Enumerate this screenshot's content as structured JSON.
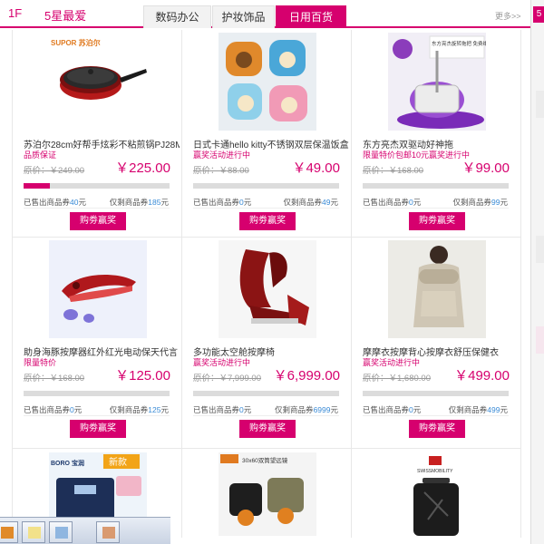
{
  "header": {
    "floor_num": "1F",
    "floor_title": "5星最爱",
    "tabs": [
      "数码办公",
      "护妆饰品",
      "日用百货"
    ],
    "active_tab": "日用百货",
    "more": "更多>>",
    "side_tab": "5"
  },
  "colors": {
    "accent": "#d6006e",
    "count": "#3a8bd6",
    "bar": "#dcdcdc"
  },
  "buy_label": "购劵赢奖",
  "sold_prefix": "已售出商品券",
  "left_prefix": "仅剩商品券",
  "unit": "元",
  "products": [
    {
      "name": "苏泊尔28cm好帮手炫彩不粘煎锅PJ28M4",
      "tag": "品质保证",
      "orig": "原价：￥249.00",
      "price": "￥225.00",
      "sold": "40",
      "left": "185",
      "progress": 0.18,
      "icon": "frying-pan",
      "brand": "SUPOR 苏泊尔"
    },
    {
      "name": "日式卡通hello kitty不锈钢双层保温饭盒",
      "tag": "赢奖活动进行中",
      "orig": "原价：￥88.00",
      "price": "￥49.00",
      "sold": "0",
      "left": "49",
      "progress": 0,
      "icon": "lunch-box"
    },
    {
      "name": "东方亮杰双驱动好神拖",
      "tag": "限量特价包邮10元赢奖进行中",
      "orig": "原价：￥168.00",
      "price": "￥99.00",
      "sold": "0",
      "left": "99",
      "progress": 0,
      "icon": "spin-mop",
      "badge": "东方亮杰旋转拖把 免费维修 100% 保证品质"
    },
    {
      "name": "助身海豚按摩器红外红光电动保天代言",
      "tag": "限量特价",
      "orig": "原价：￥168.00",
      "price": "￥125.00",
      "sold": "0",
      "left": "125",
      "progress": 0,
      "icon": "dolphin-massager"
    },
    {
      "name": "多功能太空舱按摩椅",
      "tag": "赢奖活动进行中",
      "orig": "原价：￥7,999.00",
      "price": "￥6,999.00",
      "sold": "0",
      "left": "6999",
      "progress": 0,
      "icon": "massage-chair"
    },
    {
      "name": "摩摩衣按摩背心按摩衣舒压保健衣",
      "tag": "赢奖活动进行中",
      "orig": "原价：￥1,680.00",
      "price": "￥499.00",
      "sold": "0",
      "left": "499",
      "progress": 0,
      "icon": "massage-vest"
    },
    {
      "name": "",
      "icon": "scale",
      "brand": "BORO 宝润",
      "badge": "新款"
    },
    {
      "name": "",
      "icon": "binoculars",
      "badge": "30x60双筒望远镜"
    },
    {
      "name": "",
      "icon": "suitcase",
      "brand": "SWISSMOBILITY"
    }
  ]
}
